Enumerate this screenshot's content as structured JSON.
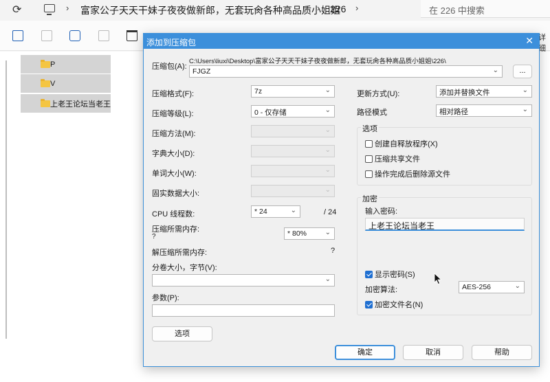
{
  "explorer": {
    "breadcrumb": [
      "富家公子天天干妹子夜夜做新郎，无套玩肏各种高品质小姐姐",
      "226"
    ],
    "search_placeholder": "在 226 中搜索",
    "toolbar_more": "详细",
    "folders": [
      "P",
      "V",
      "上老王论坛当老王"
    ]
  },
  "dialog": {
    "title": "添加到压缩包",
    "archive_label": "压缩包(A):",
    "archive_path": "C:\\Users\\liuxi\\Desktop\\富家公子天天干妹子夜夜做新郎，无套玩肏各种高品质小姐姐\\226\\",
    "archive_name": "FJGZ",
    "browse_label": "...",
    "format_label": "压缩格式(F):",
    "format_value": "7z",
    "level_label": "压缩等级(L):",
    "level_value": "0 - 仅存储",
    "method_label": "压缩方法(M):",
    "dict_label": "字典大小(D):",
    "word_label": "单词大小(W):",
    "solid_label": "固实数据大小:",
    "cpu_label": "CPU 线程数:",
    "cpu_value": "* 24",
    "cpu_total": "/ 24",
    "mem_label": "压缩所需内存:",
    "mem_q": "?",
    "mem_value": "* 80%",
    "dmem_label": "解压缩所需内存:",
    "dmem_q": "?",
    "split_label": "分卷大小，字节(V):",
    "split_value": "",
    "params_label": "参数(P):",
    "params_value": "",
    "options_button": "选项",
    "update_label": "更新方式(U):",
    "update_value": "添加并替换文件",
    "path_label": "路径模式",
    "path_value": "相对路径",
    "options_group": "选项",
    "opt_sfx": "创建自释放程序(X)",
    "opt_shared": "压缩共享文件",
    "opt_delete": "操作完成后删除源文件",
    "encryption_group": "加密",
    "pwd_label": "输入密码:",
    "pwd_value": "上老王论坛当老王",
    "show_pwd": "显示密码(S)",
    "enc_method_label": "加密算法:",
    "enc_method_value": "AES-256",
    "enc_names": "加密文件名(N)",
    "ok_button": "确定",
    "cancel_button": "取消",
    "help_button": "帮助"
  }
}
